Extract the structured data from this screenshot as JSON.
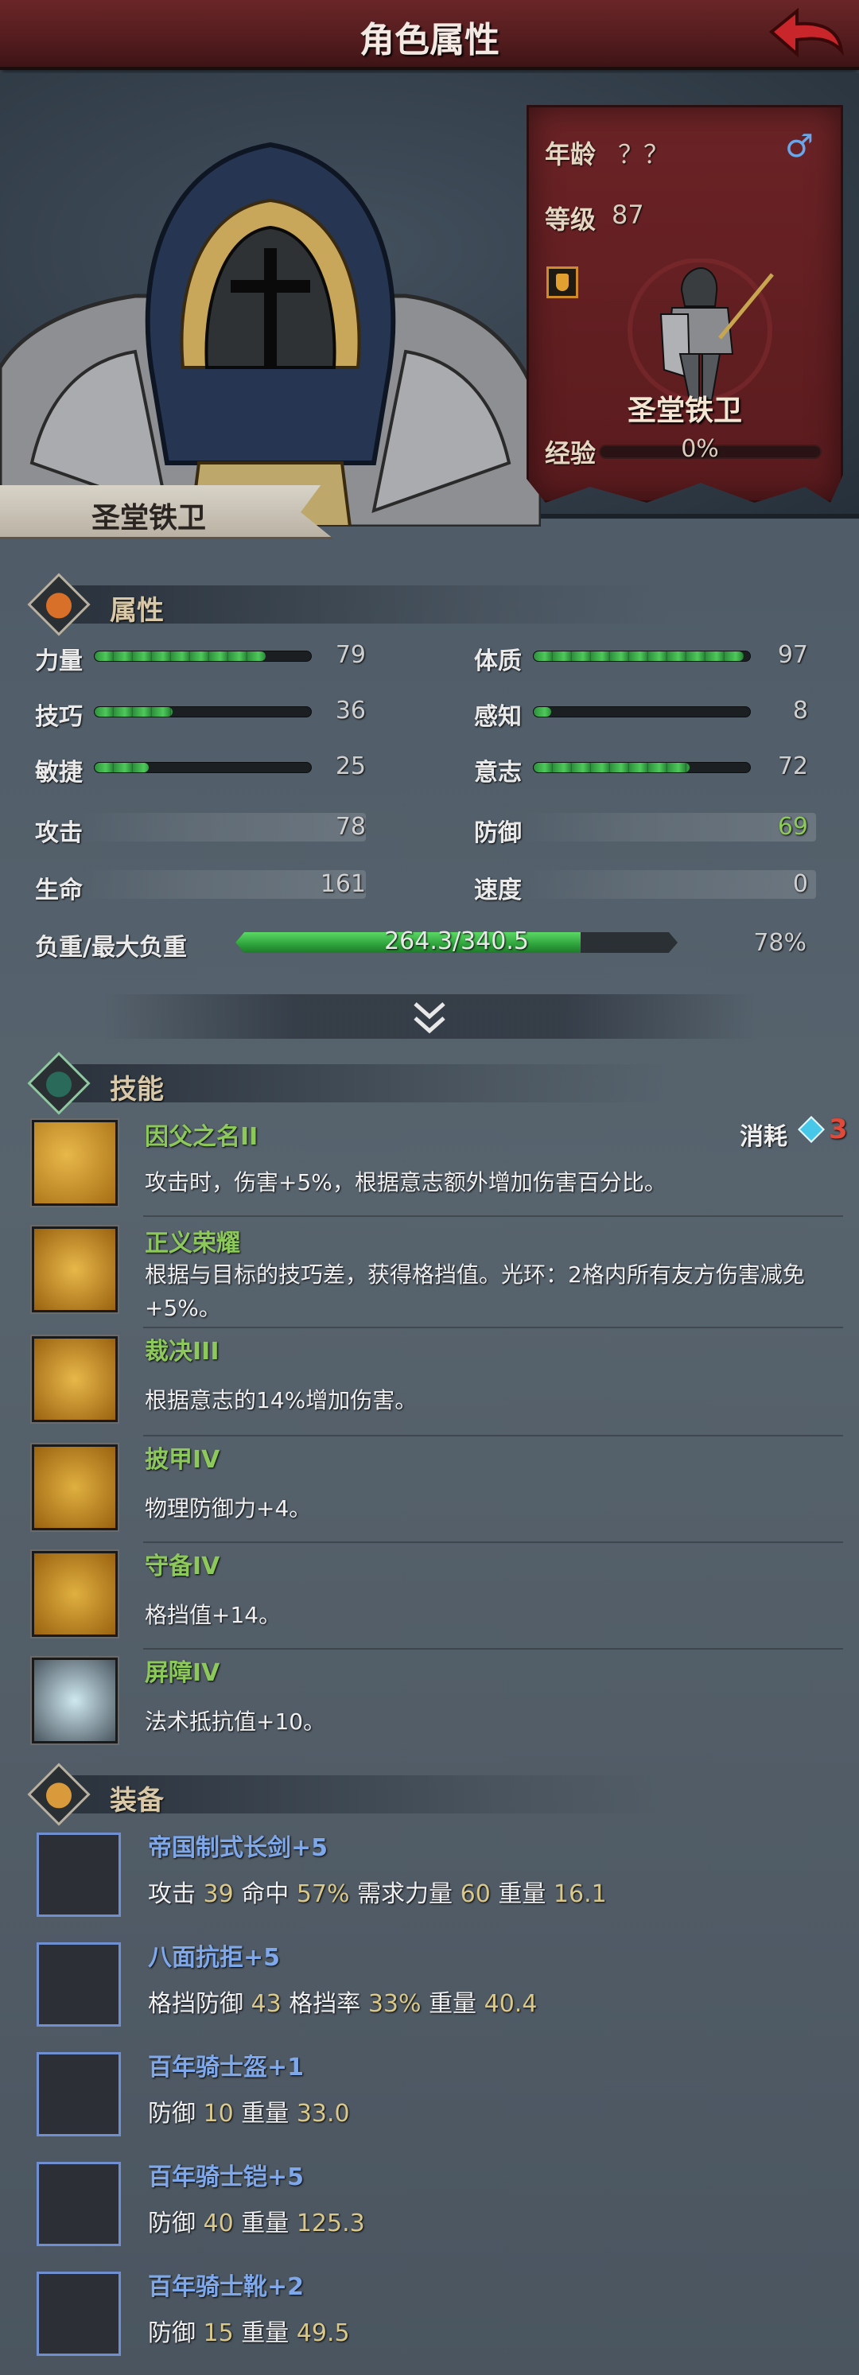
{
  "header": {
    "title": "角色属性"
  },
  "hero": {
    "name": "圣堂铁卫",
    "age_label": "年龄",
    "age_value": "？？",
    "gender": "♂",
    "level_label": "等级",
    "level_value": "87",
    "class_name": "圣堂铁卫",
    "xp_label": "经验",
    "xp_value": "0%",
    "xp_fraction": 0
  },
  "attributes": {
    "title": "属性",
    "bars": [
      {
        "label": "力量",
        "value": "79",
        "fill": 0.79
      },
      {
        "label": "体质",
        "value": "97",
        "fill": 0.97
      },
      {
        "label": "技巧",
        "value": "36",
        "fill": 0.36
      },
      {
        "label": "感知",
        "value": "8",
        "fill": 0.08
      },
      {
        "label": "敏捷",
        "value": "25",
        "fill": 0.25
      },
      {
        "label": "意志",
        "value": "72",
        "fill": 0.72
      }
    ],
    "stats": [
      {
        "label": "攻击",
        "value": "78"
      },
      {
        "label": "防御",
        "value": "69"
      },
      {
        "label": "生命",
        "value": "161"
      },
      {
        "label": "速度",
        "value": "0"
      }
    ],
    "load": {
      "label": "负重/最大负重",
      "value": "264.3/340.5",
      "percent": "78%",
      "fill": 0.78
    }
  },
  "skills": {
    "title": "技能",
    "cost_label": "消耗",
    "cost_value": "3",
    "items": [
      {
        "name": "因父之名II",
        "desc": "攻击时，伤害+5%，根据意志额外增加伤害百分比。"
      },
      {
        "name": "正义荣耀",
        "desc": "根据与目标的技巧差，获得格挡值。光环：2格内所有友方伤害减免+5%。"
      },
      {
        "name": "裁决III",
        "desc": "根据意志的14%增加伤害。"
      },
      {
        "name": "披甲IV",
        "desc": "物理防御力+4。"
      },
      {
        "name": "守备IV",
        "desc": "格挡值+14。"
      },
      {
        "name": "屏障IV",
        "desc": "法术抵抗值+10。"
      }
    ]
  },
  "equipment": {
    "title": "装备",
    "items": [
      {
        "name": "帝国制式长剑",
        "plus": "+5",
        "stats": [
          [
            "攻击",
            "39"
          ],
          [
            "命中",
            "57%"
          ],
          [
            "需求力量",
            "60"
          ],
          [
            "重量",
            "16.1"
          ]
        ]
      },
      {
        "name": "八面抗拒",
        "plus": "+5",
        "stats": [
          [
            "格挡防御",
            "43"
          ],
          [
            "格挡率",
            "33%"
          ],
          [
            "重量",
            "40.4"
          ]
        ]
      },
      {
        "name": "百年骑士盔",
        "plus": "+1",
        "stats": [
          [
            "防御",
            "10"
          ],
          [
            "重量",
            "33.0"
          ]
        ]
      },
      {
        "name": "百年骑士铠",
        "plus": "+5",
        "stats": [
          [
            "防御",
            "40"
          ],
          [
            "重量",
            "125.3"
          ]
        ]
      },
      {
        "name": "百年骑士靴",
        "plus": "+2",
        "stats": [
          [
            "防御",
            "15"
          ],
          [
            "重量",
            "49.5"
          ]
        ]
      }
    ]
  },
  "colors": {
    "accent_red": "#5a1b1e",
    "skill_green": "#8dc85a",
    "equip_blue": "#7fa8ea",
    "cost_red": "#e04a3a",
    "gem": "#48c8e8"
  }
}
